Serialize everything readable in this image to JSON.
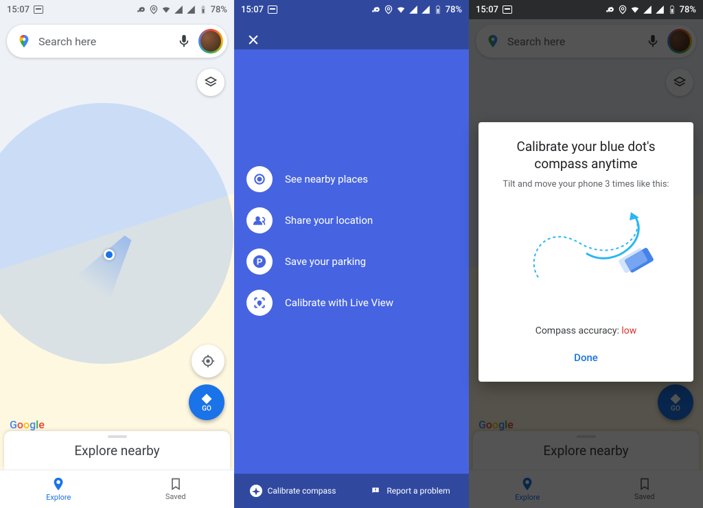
{
  "status": {
    "time": "15:07",
    "battery": "78%"
  },
  "search": {
    "placeholder": "Search here"
  },
  "layers": "layers",
  "go": "GO",
  "google": {
    "g": "G",
    "o1": "o",
    "o2": "o",
    "g2": "g",
    "l": "l",
    "e": "e"
  },
  "explore_card": "Explore nearby",
  "nav": {
    "explore": "Explore",
    "saved": "Saved"
  },
  "menu": {
    "items": [
      {
        "label": "See nearby places"
      },
      {
        "label": "Share your location"
      },
      {
        "label": "Save your parking"
      },
      {
        "label": "Calibrate with Live View"
      }
    ]
  },
  "p2footer": {
    "calibrate": "Calibrate compass",
    "report": "Report a problem"
  },
  "dialog": {
    "title": "Calibrate your blue dot's compass anytime",
    "subtitle": "Tilt and move your phone 3 times like this:",
    "accuracy_label": "Compass accuracy: ",
    "accuracy_value": "low",
    "done": "Done"
  }
}
